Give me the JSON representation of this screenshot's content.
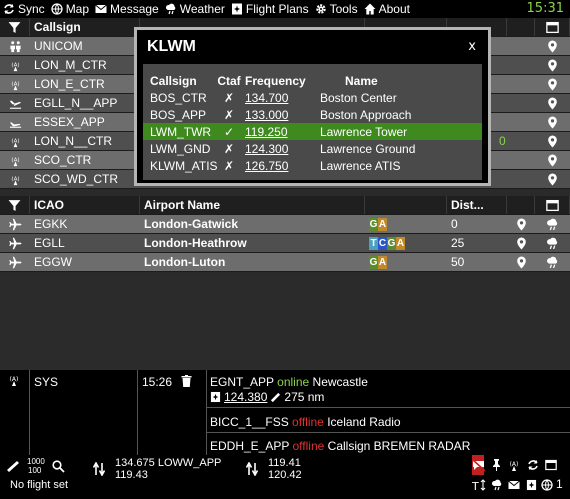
{
  "clock": "15:31",
  "menu": [
    {
      "label": "Sync",
      "icon": "sync-icon"
    },
    {
      "label": "Map",
      "icon": "map-icon"
    },
    {
      "label": "Message",
      "icon": "envelope-icon"
    },
    {
      "label": "Weather",
      "icon": "weather-icon"
    },
    {
      "label": "Flight Plans",
      "icon": "flight-plan-icon"
    },
    {
      "label": "Tools",
      "icon": "gear-icon"
    },
    {
      "label": "About",
      "icon": "home-icon"
    }
  ],
  "atc_table": {
    "header": {
      "callsign": "Callsign"
    },
    "rows": [
      {
        "icon": "unicom-icon",
        "callsign": "UNICOM",
        "extra": ""
      },
      {
        "icon": "radar-icon",
        "callsign": "LON_M_CTR",
        "extra": ""
      },
      {
        "icon": "radar-icon",
        "callsign": "LON_E_CTR",
        "extra": ""
      },
      {
        "icon": "approach-icon",
        "callsign": "EGLL_N__APP",
        "extra": ""
      },
      {
        "icon": "approach-icon",
        "callsign": "ESSEX_APP",
        "extra": ""
      },
      {
        "icon": "radar-icon",
        "callsign": "LON_N__CTR",
        "extra": "0"
      },
      {
        "icon": "radar-icon",
        "callsign": "SCO_CTR",
        "extra": ""
      },
      {
        "icon": "radar-icon",
        "callsign": "SCO_WD_CTR",
        "extra": ""
      }
    ]
  },
  "airport_table": {
    "header": {
      "icao": "ICAO",
      "name": "Airport Name",
      "dist": "Dist..."
    },
    "rows": [
      {
        "icao": "EGKK",
        "name": "London-Gatwick",
        "badges": [
          "G",
          "A"
        ],
        "dist": "0"
      },
      {
        "icao": "EGLL",
        "name": "London-Heathrow",
        "badges": [
          "T",
          "C",
          "G",
          "A"
        ],
        "dist": "25"
      },
      {
        "icao": "EGGW",
        "name": "London-Luton",
        "badges": [
          "G",
          "A"
        ],
        "dist": "50"
      }
    ]
  },
  "popup": {
    "title": "KLWM",
    "close": "x",
    "headers": {
      "callsign": "Callsign",
      "ctaf": "Ctaf",
      "frequency": "Frequency",
      "name": "Name"
    },
    "rows": [
      {
        "callsign": "BOS_CTR",
        "ctaf": "✗",
        "frequency": "134.700",
        "name": "Boston Center",
        "selected": false
      },
      {
        "callsign": "BOS_APP",
        "ctaf": "✗",
        "frequency": "133.000",
        "name": "Boston Approach",
        "selected": false
      },
      {
        "callsign": "LWM_TWR",
        "ctaf": "✓",
        "frequency": "119.250",
        "name": "Lawrence Tower",
        "selected": true
      },
      {
        "callsign": "LWM_GND",
        "ctaf": "✗",
        "frequency": "124.300",
        "name": "Lawrence Ground",
        "selected": false
      },
      {
        "callsign": "KLWM_ATIS",
        "ctaf": "✗",
        "frequency": "126.750",
        "name": "Lawrence ATIS",
        "selected": false
      }
    ]
  },
  "chat": {
    "channel": "SYS",
    "time": "15:26",
    "messages": [
      {
        "callsign": "EGNT_APP",
        "status": "online",
        "name": "Newcastle",
        "frequency": "124.380",
        "distance": "275 nm"
      },
      {
        "callsign": "BICC_1__FSS",
        "status": "offline",
        "name": "Iceland Radio"
      },
      {
        "callsign": "EDDH_E_APP",
        "status": "offline",
        "name": "Callsign BREMEN RADAR"
      }
    ]
  },
  "status": {
    "zoom_top": "1000",
    "zoom_bottom": "100",
    "flight": "No flight set",
    "com1_freq": "134.675",
    "com1_station": "LOWW_APP",
    "com1_standby": "119.43",
    "com2_freq": "119.41",
    "com2_standby": "120.42",
    "users": "1"
  }
}
